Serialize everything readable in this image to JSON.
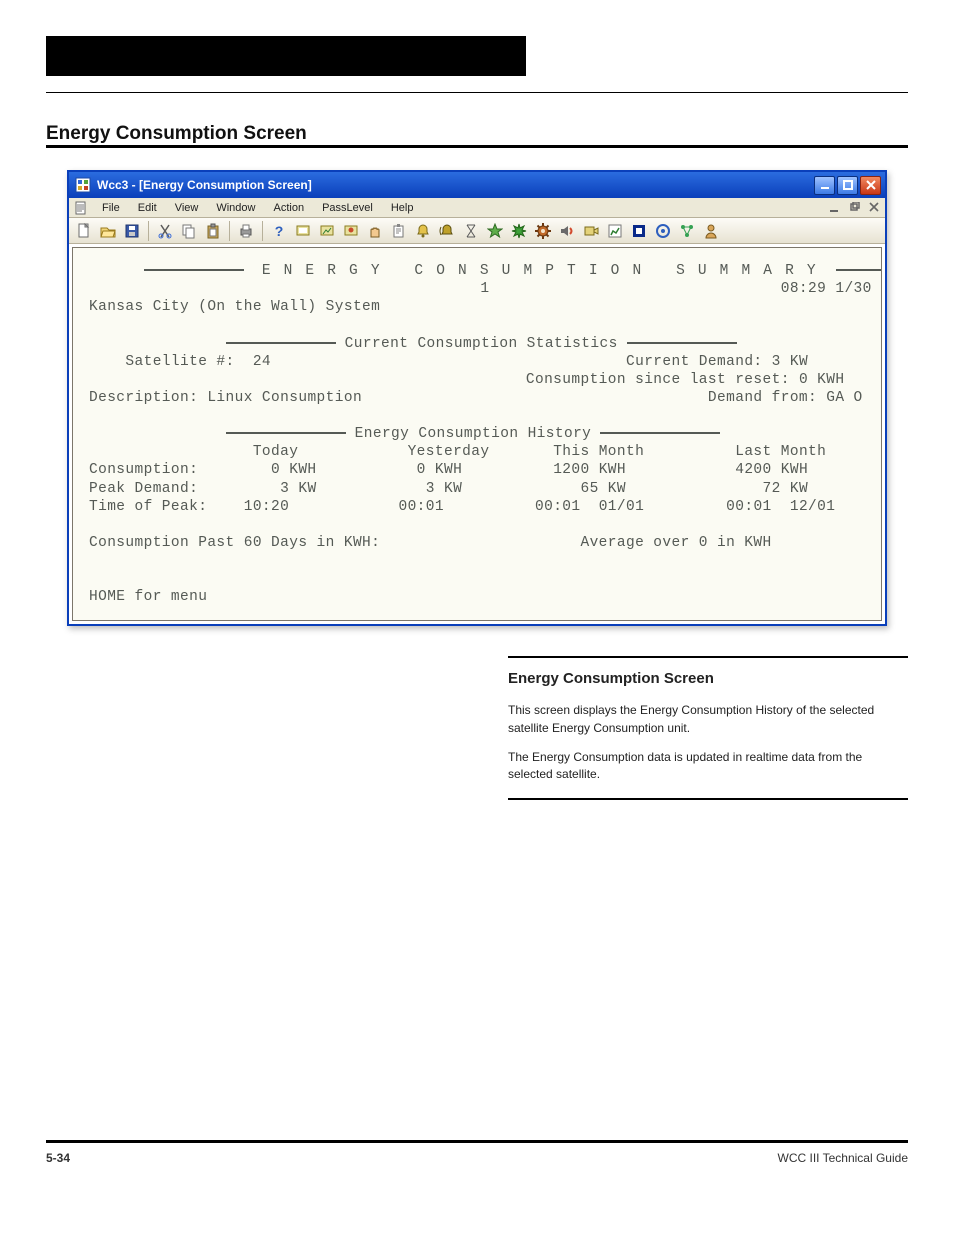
{
  "doc": {
    "masthead_label": " ",
    "section_title": "Energy Consumption Screen",
    "footer_left": "5-34",
    "footer_right": "WCC III Technical Guide"
  },
  "appwin": {
    "title": "Wcc3 - [Energy Consumption Screen]",
    "menus": [
      "File",
      "Edit",
      "View",
      "Window",
      "Action",
      "PassLevel",
      "Help"
    ],
    "toolbar_icons": [
      "new-icon",
      "open-icon",
      "save-icon",
      "|",
      "cut-icon",
      "copy-icon",
      "paste-icon",
      "|",
      "print-icon",
      "|",
      "help-icon",
      "screen1-icon",
      "screen2-icon",
      "wand-icon",
      "hand-icon",
      "clipboard-icon",
      "bell-icon",
      "bell2-icon",
      "hourglass-icon",
      "star-icon",
      "burst-icon",
      "gear-icon",
      "sound-icon",
      "record-icon",
      "chart-icon",
      "stop-icon",
      "target-icon",
      "network-icon",
      "user-icon"
    ]
  },
  "terminal": {
    "banner_title": "E N E R G Y   C O N S U M P T I O N   S U M M A R Y",
    "page_number": "1",
    "clock": "08:29 1/30",
    "system_name": "Kansas City (On the Wall) System",
    "stats_heading": "Current Consumption Statistics",
    "satellite_label": "Satellite #:",
    "satellite_value": "24",
    "current_demand_label": "Current Demand:",
    "current_demand_value": "3 KW",
    "since_reset_label": "Consumption since last reset:",
    "since_reset_value": "0 KWH",
    "description_label": "Description:",
    "description_value": "Linux Consumption",
    "demand_from_label": "Demand from:",
    "demand_from_value": "GA O",
    "history_heading": "Energy Consumption History",
    "columns": [
      "Today",
      "Yesterday",
      "This Month",
      "Last Month"
    ],
    "rows": {
      "consumption": {
        "label": "Consumption:",
        "values": [
          "0 KWH",
          "0 KWH",
          "1200 KWH",
          "4200 KWH"
        ]
      },
      "peak": {
        "label": "Peak Demand:",
        "values": [
          "3 KW",
          "3 KW",
          "65 KW",
          "72 KW"
        ]
      },
      "timepeak": {
        "label": "Time of Peak:",
        "values": [
          "10:20",
          "00:01",
          "00:01  01/01",
          "00:01  12/01"
        ]
      }
    },
    "past60_label": "Consumption Past 60 Days in KWH:",
    "avg_label": "Average over 0 in KWH",
    "home_hint": "HOME for menu"
  },
  "rightcol": {
    "heading": "Energy Consumption Screen",
    "p1": "This screen displays the Energy Consumption History of the selected satellite Energy Consumption unit.",
    "p2": "The Energy Consumption data is updated in realtime data from the selected satellite."
  }
}
